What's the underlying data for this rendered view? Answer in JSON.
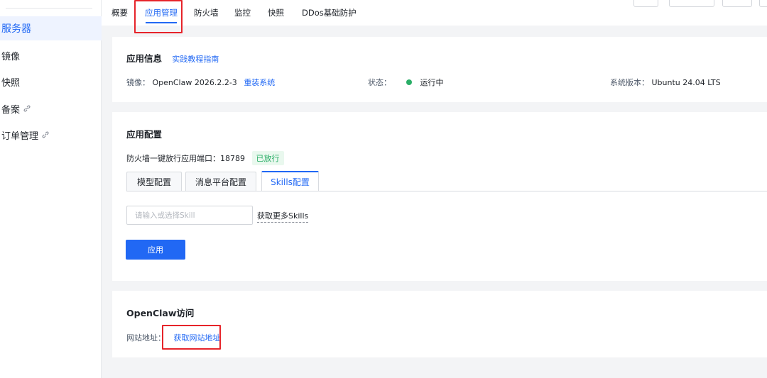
{
  "sidebar": {
    "items": [
      {
        "label": "服务器",
        "active": true,
        "external": false
      },
      {
        "label": "镜像",
        "active": false,
        "external": false
      },
      {
        "label": "快照",
        "active": false,
        "external": false
      },
      {
        "label": "备案",
        "active": false,
        "external": true
      },
      {
        "label": "订单管理",
        "active": false,
        "external": true
      }
    ]
  },
  "header": {
    "tabs": [
      {
        "label": "概要",
        "active": false
      },
      {
        "label": "应用管理",
        "active": true
      },
      {
        "label": "防火墙",
        "active": false
      },
      {
        "label": "监控",
        "active": false
      },
      {
        "label": "快照",
        "active": false
      },
      {
        "label": "DDos基础防护",
        "active": false
      }
    ]
  },
  "app_info": {
    "title": "应用信息",
    "tutorial_link": "实践教程指南",
    "image_label": "镜像：",
    "image_value": "OpenClaw 2026.2.2-3",
    "reinstall_link": "重装系统",
    "status_label": "状态：",
    "status_value": "运行中",
    "os_label": "系统版本：",
    "os_value": "Ubuntu 24.04 LTS"
  },
  "app_config": {
    "title": "应用配置",
    "firewall_text": "防火墙一键放行应用端口：18789",
    "firewall_tag": "已放行",
    "tabs": [
      {
        "label": "模型配置",
        "active": false
      },
      {
        "label": "消息平台配置",
        "active": false
      },
      {
        "label": "Skills配置",
        "active": true
      }
    ],
    "skill_input_placeholder": "请输入或选择Skill",
    "skill_input_value": "",
    "more_skills_link": "获取更多Skills",
    "apply_button": "应用"
  },
  "access": {
    "title": "OpenClaw访问",
    "site_label": "网站地址：",
    "get_address_link": "获取网站地址"
  },
  "colors": {
    "accent": "#2168f4",
    "highlight_box": "#e6242a",
    "status_running": "#2aae67"
  }
}
